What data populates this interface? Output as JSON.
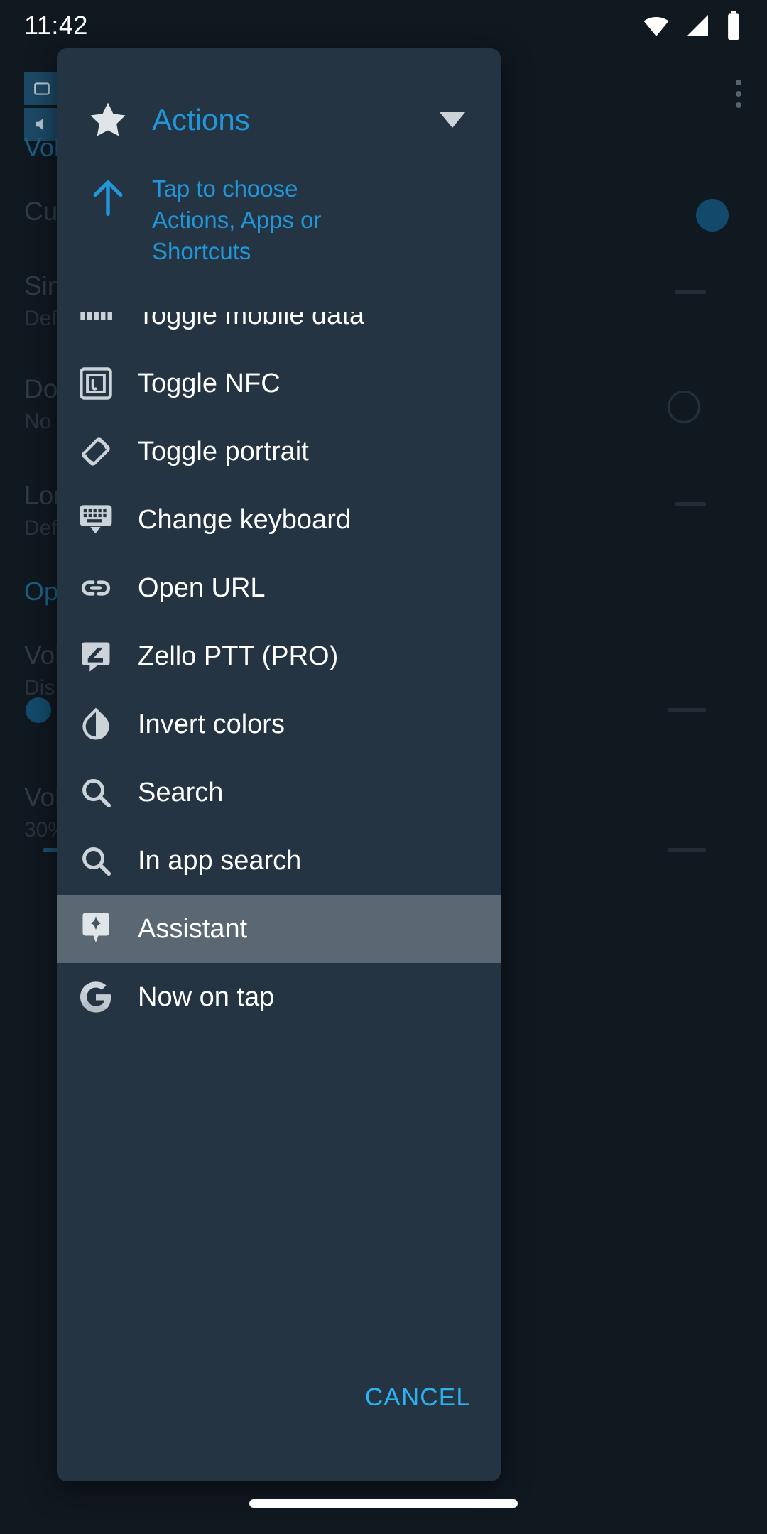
{
  "status_bar": {
    "time": "11:42",
    "icons": [
      "wifi-icon",
      "signal-icon",
      "battery-icon"
    ]
  },
  "background_screen": {
    "toolbar_icons": [
      "window-icon",
      "back-icon",
      "volume-icon",
      "home-icon"
    ],
    "overflow_icon": "more-vertical-icon",
    "rows": [
      {
        "title": "Volume keys",
        "subtitle": ""
      },
      {
        "title": "Cus",
        "subtitle": ""
      },
      {
        "title": "Sin",
        "subtitle": "Def"
      },
      {
        "title": "Dou",
        "subtitle": "No "
      },
      {
        "title": "Lon",
        "subtitle": "Def"
      },
      {
        "title": "Opt",
        "subtitle": ""
      },
      {
        "title": "Vol",
        "subtitle": "Dis"
      },
      {
        "title": "Vol",
        "subtitle": "30%"
      }
    ]
  },
  "dialog": {
    "icon": "star-icon",
    "title": "Actions",
    "dropdown_icon": "caret-down-icon",
    "hint_icon": "arrow-up-icon",
    "hint_text": "Tap to choose Actions, Apps or Shortcuts",
    "items": [
      {
        "icon": "signal-bars-icon",
        "label": "Toggle mobile data",
        "selected": false,
        "clipped": true
      },
      {
        "icon": "nfc-icon",
        "label": "Toggle NFC",
        "selected": false
      },
      {
        "icon": "screen-rotation-icon",
        "label": "Toggle portrait",
        "selected": false
      },
      {
        "icon": "keyboard-icon",
        "label": "Change keyboard",
        "selected": false
      },
      {
        "icon": "link-icon",
        "label": "Open URL",
        "selected": false
      },
      {
        "icon": "zello-icon",
        "label": "Zello PTT (PRO)",
        "selected": false
      },
      {
        "icon": "invert-colors-icon",
        "label": "Invert colors",
        "selected": false
      },
      {
        "icon": "search-icon",
        "label": "Search",
        "selected": false
      },
      {
        "icon": "search-icon",
        "label": "In app search",
        "selected": false
      },
      {
        "icon": "assistant-icon",
        "label": "Assistant",
        "selected": true
      },
      {
        "icon": "google-g-icon",
        "label": "Now on tap",
        "selected": false
      }
    ],
    "cancel_label": "CANCEL"
  },
  "nav_bar": {
    "handle": "gesture-pill"
  },
  "colors": {
    "accent_blue": "#2196d9",
    "cancel_blue": "#2bb2f0",
    "dialog_bg": "#243442",
    "screen_bg": "#101820",
    "selected_row": "#5a6873",
    "icon_gray": "#ccd3d8",
    "text_white": "#ffffff"
  }
}
